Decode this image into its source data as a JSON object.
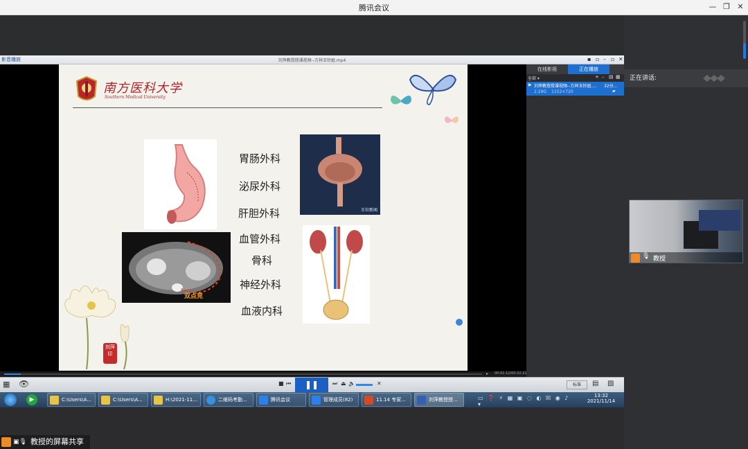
{
  "meeting": {
    "app_title": "腾讯会议",
    "speaking_label": "正在讲话:",
    "participant_name": "教授",
    "share_label": "教授的屏幕共享"
  },
  "player": {
    "logo_text": "影音播放",
    "file_title": "刘萍教授授课视频--方祥玉铃姐.mp4",
    "tabs": [
      "在线影视",
      "正在播放"
    ],
    "toolbar_all": "全部 ▾",
    "playlist_item": {
      "title": "刘萍教授授课视频--方祥玉铃姐.mp4",
      "duration": "32分...",
      "size": "2.29G",
      "resolution": "1152×720"
    },
    "time_display": "00:01:12/00:32:21",
    "extra_buttons": [
      "标准",
      "",
      ""
    ]
  },
  "slide": {
    "university_cn": "南方医科大学",
    "university_en": "Southern Medical University",
    "departments": [
      "胃肠外科",
      "泌尿外科",
      "肝胆外科",
      "血管外科",
      "骨科",
      "神经外科",
      "血液内科"
    ],
    "seal_text": "刘萍印",
    "watermark": "王社新闻",
    "ct_watermark": "双点竞"
  },
  "taskbar": {
    "items": [
      {
        "label": "C:\\Users\\A...",
        "icon": "folder-icon"
      },
      {
        "label": "C:\\Users\\A...",
        "icon": "folder-icon"
      },
      {
        "label": "H:\\2021-11...",
        "icon": "folder-icon"
      },
      {
        "label": "二维码考勤...",
        "icon": "ie-icon"
      },
      {
        "label": "腾讯会议",
        "icon": "tencent-meeting-icon"
      },
      {
        "label": "管理成员(82)",
        "icon": "tencent-meeting-icon"
      },
      {
        "label": "11.14 专家...",
        "icon": "powerpoint-icon"
      },
      {
        "label": "刘萍教授授...",
        "icon": "player-icon"
      }
    ],
    "time": "13:32",
    "date": "2021/11/14"
  },
  "colors": {
    "accent_blue": "#1e6fd0",
    "meeting_dark": "#2f3033"
  }
}
